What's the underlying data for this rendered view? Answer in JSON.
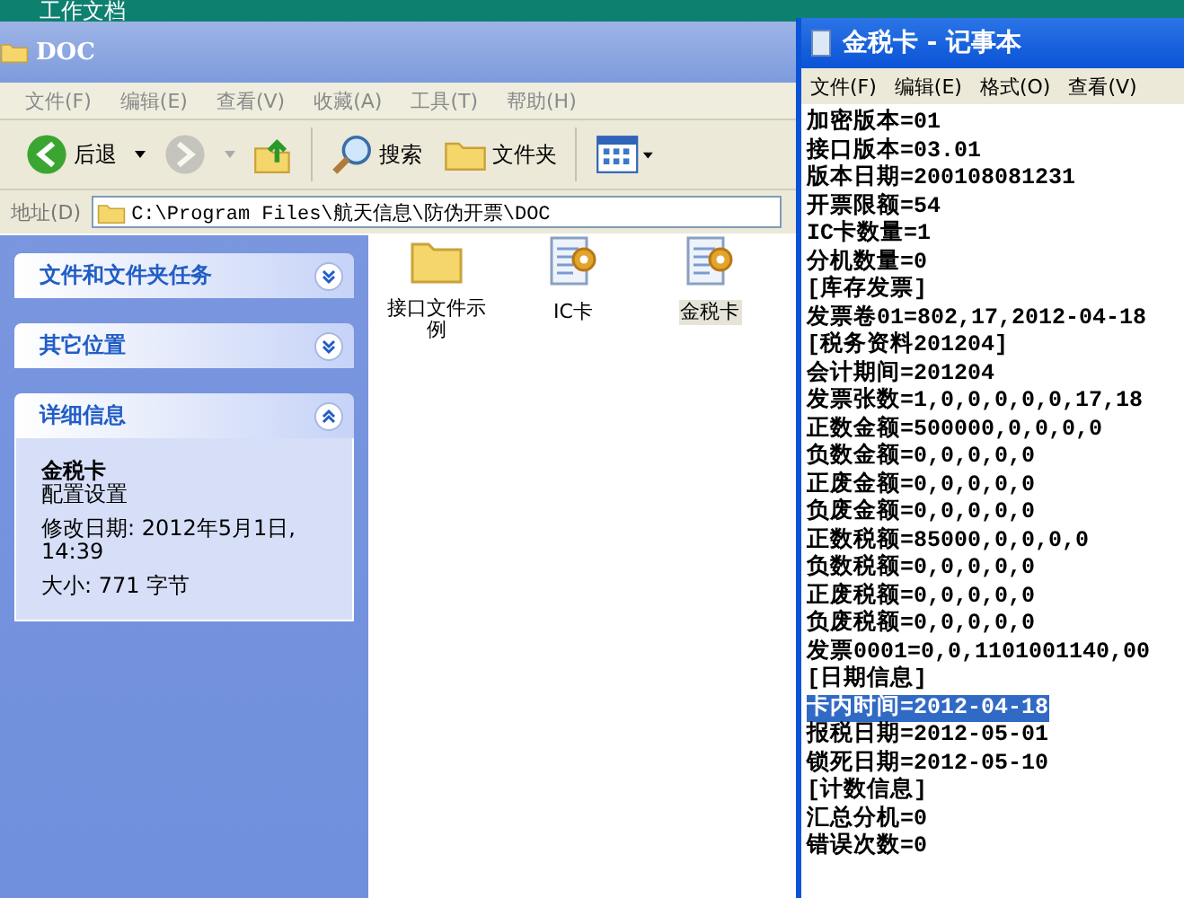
{
  "desktop_title": "工作文档",
  "explorer": {
    "title": "DOC",
    "menu": [
      "文件(F)",
      "编辑(E)",
      "查看(V)",
      "收藏(A)",
      "工具(T)",
      "帮助(H)"
    ],
    "toolbar": [
      {
        "kind": "back",
        "label": "后退",
        "disabled": false
      },
      {
        "kind": "forward",
        "disabled": true
      },
      {
        "kind": "up",
        "disabled": false
      },
      {
        "kind": "search",
        "label": "搜索",
        "disabled": false
      },
      {
        "kind": "folders",
        "label": "文件夹",
        "disabled": false
      },
      {
        "kind": "views",
        "disabled": false
      }
    ],
    "address": {
      "label": "地址(D)",
      "value": "C:\\Program Files\\航天信息\\防伪开票\\DOC"
    },
    "sidebar": [
      {
        "title": "文件和文件夹任务",
        "expanded": false
      },
      {
        "title": "其它位置",
        "expanded": false
      },
      {
        "title": "详细信息",
        "expanded": true,
        "details": {
          "name": "金税卡",
          "type": "配置设置",
          "modified": "修改日期: 2012年5月1日, 14:39",
          "size": "大小: 771 字节"
        }
      }
    ],
    "files": [
      {
        "name": "接口文件示例",
        "kind": "folder",
        "selected": false
      },
      {
        "name": "IC卡",
        "kind": "config",
        "selected": false
      },
      {
        "name": "金税卡",
        "kind": "config",
        "selected": true
      }
    ]
  },
  "notepad": {
    "title": "金税卡 - 记事本",
    "menu": [
      "文件(F)",
      "编辑(E)",
      "格式(O)",
      "查看(V)"
    ],
    "lines": [
      {
        "text": "加密版本=01",
        "selected": false
      },
      {
        "text": "接口版本=03.01",
        "selected": false
      },
      {
        "text": "版本日期=200108081231",
        "selected": false
      },
      {
        "text": "开票限额=54",
        "selected": false
      },
      {
        "text": "IC卡数量=1",
        "selected": false
      },
      {
        "text": "分机数量=0",
        "selected": false
      },
      {
        "text": "[库存发票]",
        "selected": false
      },
      {
        "text": "发票卷01=802,17,2012-04-18",
        "selected": false
      },
      {
        "text": "[税务资料201204]",
        "selected": false
      },
      {
        "text": "会计期间=201204",
        "selected": false
      },
      {
        "text": "发票张数=1,0,0,0,0,0,17,18",
        "selected": false
      },
      {
        "text": "正数金额=500000,0,0,0,0",
        "selected": false
      },
      {
        "text": "负数金额=0,0,0,0,0",
        "selected": false
      },
      {
        "text": "正废金额=0,0,0,0,0",
        "selected": false
      },
      {
        "text": "负废金额=0,0,0,0,0",
        "selected": false
      },
      {
        "text": "正数税额=85000,0,0,0,0",
        "selected": false
      },
      {
        "text": "负数税额=0,0,0,0,0",
        "selected": false
      },
      {
        "text": "正废税额=0,0,0,0,0",
        "selected": false
      },
      {
        "text": "负废税额=0,0,0,0,0",
        "selected": false
      },
      {
        "text": "发票0001=0,0,1101001140,00",
        "selected": false
      },
      {
        "text": "[日期信息]",
        "selected": false
      },
      {
        "text": "卡内时间=2012-04-18",
        "selected": true
      },
      {
        "text": "报税日期=2012-05-01",
        "selected": false
      },
      {
        "text": "锁死日期=2012-05-10",
        "selected": false
      },
      {
        "text": "[计数信息]",
        "selected": false
      },
      {
        "text": "汇总分机=0",
        "selected": false
      },
      {
        "text": "错误次数=0",
        "selected": false
      }
    ]
  }
}
